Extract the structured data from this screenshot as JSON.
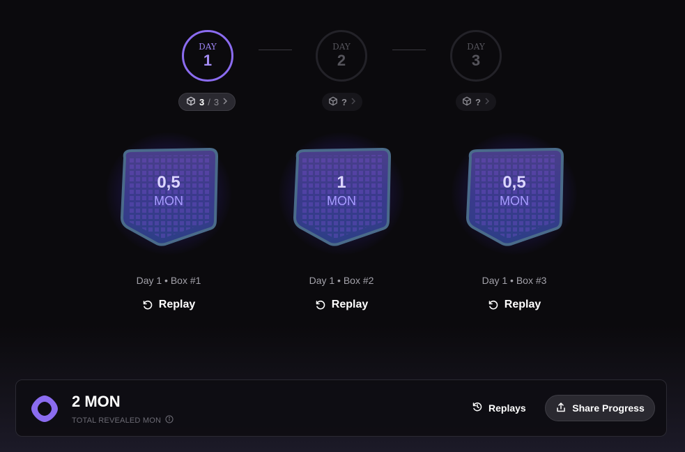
{
  "days": [
    {
      "label": "DAY",
      "number": "1",
      "state": "active",
      "opened": "3",
      "separator": "/",
      "total": "3"
    },
    {
      "label": "DAY",
      "number": "2",
      "state": "locked",
      "opened": "?"
    },
    {
      "label": "DAY",
      "number": "3",
      "state": "locked",
      "opened": "?"
    }
  ],
  "boxes": [
    {
      "value": "0,5",
      "unit": "MON",
      "caption": "Day 1 • Box #1",
      "replay": "Replay"
    },
    {
      "value": "1",
      "unit": "MON",
      "caption": "Day 1 • Box #2",
      "replay": "Replay"
    },
    {
      "value": "0,5",
      "unit": "MON",
      "caption": "Day 1 • Box #3",
      "replay": "Replay"
    }
  ],
  "summary": {
    "total": "2 MON",
    "label": "TOTAL REVEALED MON",
    "replays_label": "Replays",
    "share_label": "Share Progress"
  },
  "colors": {
    "accent": "#8b6cf0",
    "background": "#0b0a0d"
  }
}
